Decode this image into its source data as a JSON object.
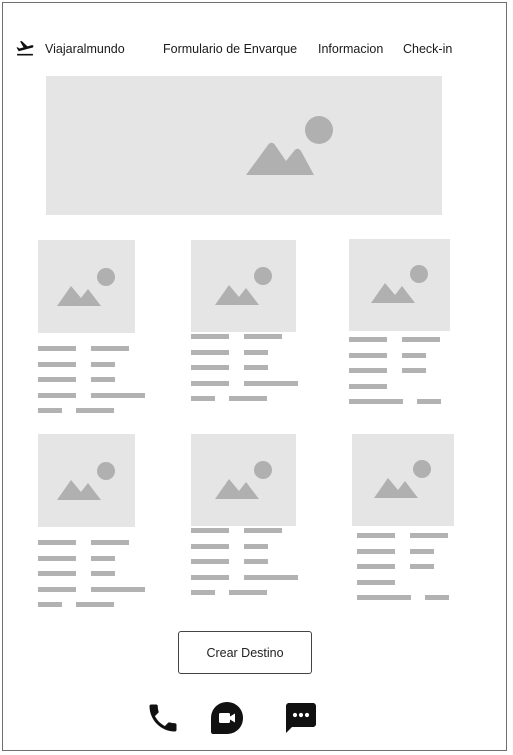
{
  "header": {
    "logo_icon": "airplane-takeoff-icon",
    "brand": "Viajaralmundo",
    "nav": [
      {
        "label": "Formulario de Envarque"
      },
      {
        "label": "Informacion"
      },
      {
        "label": "Check-in"
      }
    ]
  },
  "hero": {
    "icon": "image-placeholder-icon"
  },
  "cards": [
    {
      "icon": "image-placeholder-icon"
    },
    {
      "icon": "image-placeholder-icon"
    },
    {
      "icon": "image-placeholder-icon"
    },
    {
      "icon": "image-placeholder-icon"
    },
    {
      "icon": "image-placeholder-icon"
    },
    {
      "icon": "image-placeholder-icon"
    }
  ],
  "cta": {
    "label": "Crear Destino"
  },
  "footer": {
    "icons": [
      "phone-icon",
      "video-call-icon",
      "chat-icon"
    ]
  },
  "colors": {
    "placeholder_bg": "#e5e5e5",
    "placeholder_glyph": "#b0b0b0",
    "text_line": "#b2b2b2",
    "icon_dark": "#111111"
  }
}
